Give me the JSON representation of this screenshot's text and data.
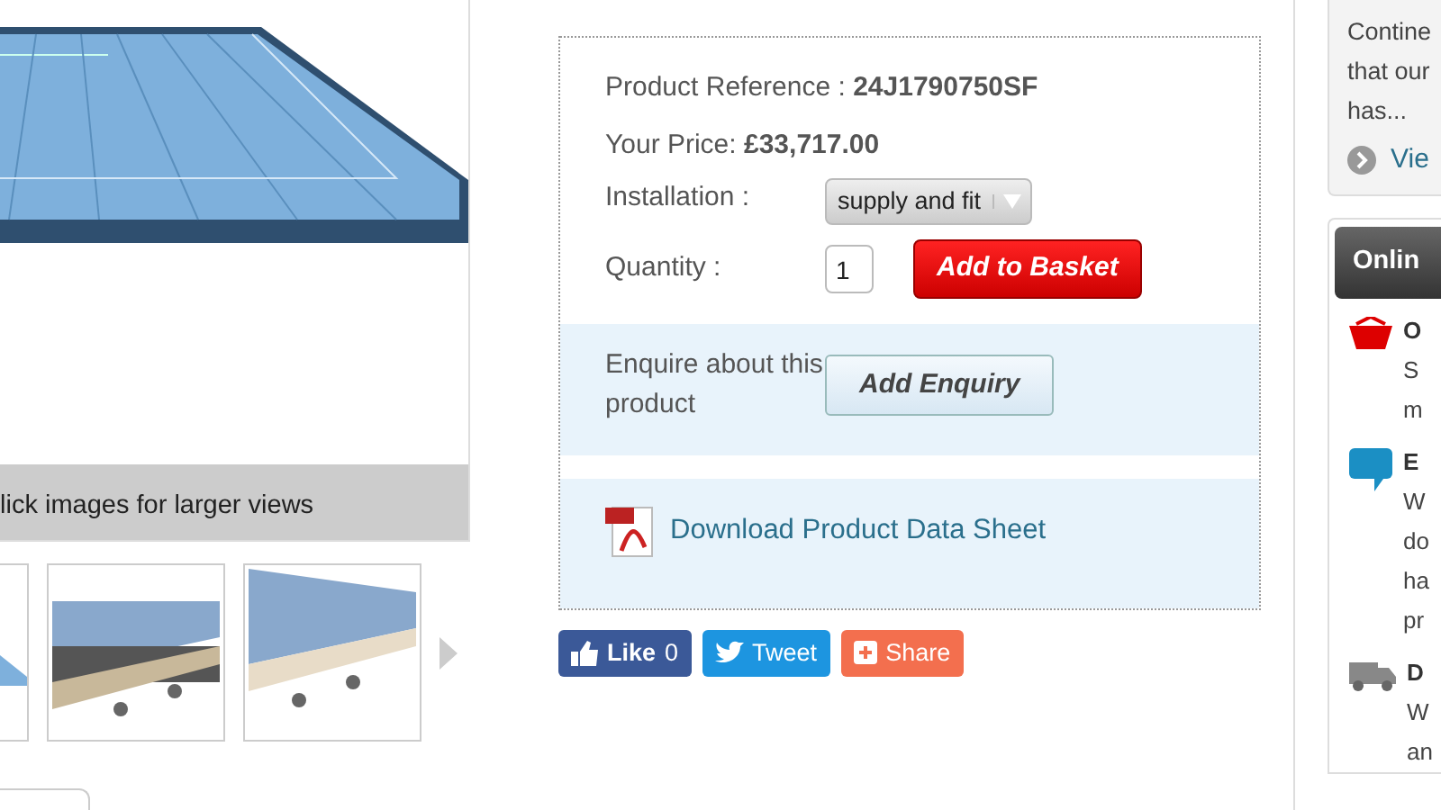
{
  "gallery": {
    "caption": "lick images for larger views"
  },
  "product": {
    "reference": "Product Reference : **24J1790750SF**",
    "price": "Your Price: **£33,717.00**",
    "installation_label": "Installation :",
    "installation_value": "supply and fit",
    "quantity_label": "Quantity :",
    "quantity": "1",
    "add_button": "Add to Basket",
    "enquire_text": "Enquire about this product",
    "enquiry_button": "Add Enquiry",
    "download_link": "Download Product Data Sheet"
  },
  "social": [
    {
      "kind": "like",
      "label": "Like",
      "count": "0"
    },
    {
      "kind": "tweet",
      "label": "Tweet"
    },
    {
      "kind": "share",
      "label": "Share"
    }
  ],
  "sidebar": {
    "news": {
      "text_lines": [
        "Contine",
        "that our",
        "has..."
      ],
      "link": "Vie"
    },
    "online": {
      "title": "Onlin",
      "items": [
        {
          "kind": "basket",
          "title": "O",
          "lines": [
            "S",
            "m"
          ]
        },
        {
          "kind": "chat",
          "title": "E",
          "lines": [
            "W",
            "do",
            "ha",
            "pr"
          ]
        },
        {
          "kind": "delivery",
          "title": "D",
          "lines": [
            "W",
            "an"
          ]
        }
      ]
    }
  }
}
